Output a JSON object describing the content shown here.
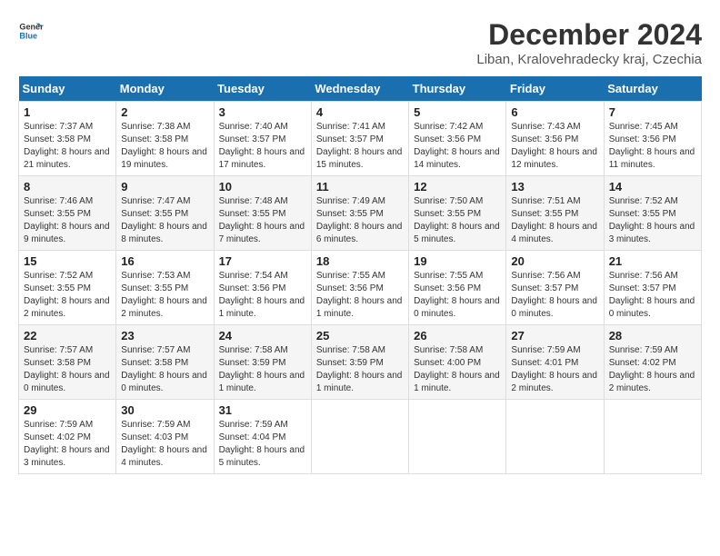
{
  "logo": {
    "line1": "General",
    "line2": "Blue"
  },
  "title": "December 2024",
  "subtitle": "Liban, Kralovehradecky kraj, Czechia",
  "weekdays": [
    "Sunday",
    "Monday",
    "Tuesday",
    "Wednesday",
    "Thursday",
    "Friday",
    "Saturday"
  ],
  "weeks": [
    [
      {
        "day": "1",
        "sunrise": "7:37 AM",
        "sunset": "3:58 PM",
        "daylight": "8 hours and 21 minutes."
      },
      {
        "day": "2",
        "sunrise": "7:38 AM",
        "sunset": "3:58 PM",
        "daylight": "8 hours and 19 minutes."
      },
      {
        "day": "3",
        "sunrise": "7:40 AM",
        "sunset": "3:57 PM",
        "daylight": "8 hours and 17 minutes."
      },
      {
        "day": "4",
        "sunrise": "7:41 AM",
        "sunset": "3:57 PM",
        "daylight": "8 hours and 15 minutes."
      },
      {
        "day": "5",
        "sunrise": "7:42 AM",
        "sunset": "3:56 PM",
        "daylight": "8 hours and 14 minutes."
      },
      {
        "day": "6",
        "sunrise": "7:43 AM",
        "sunset": "3:56 PM",
        "daylight": "8 hours and 12 minutes."
      },
      {
        "day": "7",
        "sunrise": "7:45 AM",
        "sunset": "3:56 PM",
        "daylight": "8 hours and 11 minutes."
      }
    ],
    [
      {
        "day": "8",
        "sunrise": "7:46 AM",
        "sunset": "3:55 PM",
        "daylight": "8 hours and 9 minutes."
      },
      {
        "day": "9",
        "sunrise": "7:47 AM",
        "sunset": "3:55 PM",
        "daylight": "8 hours and 8 minutes."
      },
      {
        "day": "10",
        "sunrise": "7:48 AM",
        "sunset": "3:55 PM",
        "daylight": "8 hours and 7 minutes."
      },
      {
        "day": "11",
        "sunrise": "7:49 AM",
        "sunset": "3:55 PM",
        "daylight": "8 hours and 6 minutes."
      },
      {
        "day": "12",
        "sunrise": "7:50 AM",
        "sunset": "3:55 PM",
        "daylight": "8 hours and 5 minutes."
      },
      {
        "day": "13",
        "sunrise": "7:51 AM",
        "sunset": "3:55 PM",
        "daylight": "8 hours and 4 minutes."
      },
      {
        "day": "14",
        "sunrise": "7:52 AM",
        "sunset": "3:55 PM",
        "daylight": "8 hours and 3 minutes."
      }
    ],
    [
      {
        "day": "15",
        "sunrise": "7:52 AM",
        "sunset": "3:55 PM",
        "daylight": "8 hours and 2 minutes."
      },
      {
        "day": "16",
        "sunrise": "7:53 AM",
        "sunset": "3:55 PM",
        "daylight": "8 hours and 2 minutes."
      },
      {
        "day": "17",
        "sunrise": "7:54 AM",
        "sunset": "3:56 PM",
        "daylight": "8 hours and 1 minute."
      },
      {
        "day": "18",
        "sunrise": "7:55 AM",
        "sunset": "3:56 PM",
        "daylight": "8 hours and 1 minute."
      },
      {
        "day": "19",
        "sunrise": "7:55 AM",
        "sunset": "3:56 PM",
        "daylight": "8 hours and 0 minutes."
      },
      {
        "day": "20",
        "sunrise": "7:56 AM",
        "sunset": "3:57 PM",
        "daylight": "8 hours and 0 minutes."
      },
      {
        "day": "21",
        "sunrise": "7:56 AM",
        "sunset": "3:57 PM",
        "daylight": "8 hours and 0 minutes."
      }
    ],
    [
      {
        "day": "22",
        "sunrise": "7:57 AM",
        "sunset": "3:58 PM",
        "daylight": "8 hours and 0 minutes."
      },
      {
        "day": "23",
        "sunrise": "7:57 AM",
        "sunset": "3:58 PM",
        "daylight": "8 hours and 0 minutes."
      },
      {
        "day": "24",
        "sunrise": "7:58 AM",
        "sunset": "3:59 PM",
        "daylight": "8 hours and 1 minute."
      },
      {
        "day": "25",
        "sunrise": "7:58 AM",
        "sunset": "3:59 PM",
        "daylight": "8 hours and 1 minute."
      },
      {
        "day": "26",
        "sunrise": "7:58 AM",
        "sunset": "4:00 PM",
        "daylight": "8 hours and 1 minute."
      },
      {
        "day": "27",
        "sunrise": "7:59 AM",
        "sunset": "4:01 PM",
        "daylight": "8 hours and 2 minutes."
      },
      {
        "day": "28",
        "sunrise": "7:59 AM",
        "sunset": "4:02 PM",
        "daylight": "8 hours and 2 minutes."
      }
    ],
    [
      {
        "day": "29",
        "sunrise": "7:59 AM",
        "sunset": "4:02 PM",
        "daylight": "8 hours and 3 minutes."
      },
      {
        "day": "30",
        "sunrise": "7:59 AM",
        "sunset": "4:03 PM",
        "daylight": "8 hours and 4 minutes."
      },
      {
        "day": "31",
        "sunrise": "7:59 AM",
        "sunset": "4:04 PM",
        "daylight": "8 hours and 5 minutes."
      },
      null,
      null,
      null,
      null
    ]
  ]
}
